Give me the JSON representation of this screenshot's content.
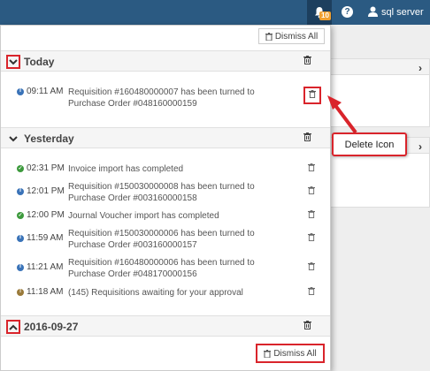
{
  "topbar": {
    "notification_count": "10",
    "help_label": "?",
    "user_name": "sql server"
  },
  "dropdown": {
    "dismiss_all_label": "Dismiss All",
    "groups": [
      {
        "title": "Today",
        "collapsed": false,
        "items": [
          {
            "time": "09:11 AM",
            "status": "info",
            "message": "Requisition #160480000007 has been turned to Purchase Order #048160000159"
          }
        ]
      },
      {
        "title": "Yesterday",
        "collapsed": false,
        "items": [
          {
            "time": "02:31 PM",
            "status": "ok",
            "message": "Invoice import has completed"
          },
          {
            "time": "12:01 PM",
            "status": "info",
            "message": "Requisition #150030000008 has been turned to Purchase Order #003160000158"
          },
          {
            "time": "12:00 PM",
            "status": "ok",
            "message": "Journal Voucher import has completed"
          },
          {
            "time": "11:59 AM",
            "status": "info",
            "message": "Requisition #150030000006 has been turned to Purchase Order #003160000157"
          },
          {
            "time": "11:21 AM",
            "status": "info",
            "message": "Requisition #160480000006 has been turned to Purchase Order #048170000156"
          },
          {
            "time": "11:18 AM",
            "status": "warn",
            "message": "(145) Requisitions awaiting for your approval"
          }
        ]
      },
      {
        "title": "2016-09-27",
        "collapsed": true,
        "items": []
      }
    ]
  },
  "annotation": {
    "callout_label": "Delete Icon",
    "color": "#d9242b"
  }
}
